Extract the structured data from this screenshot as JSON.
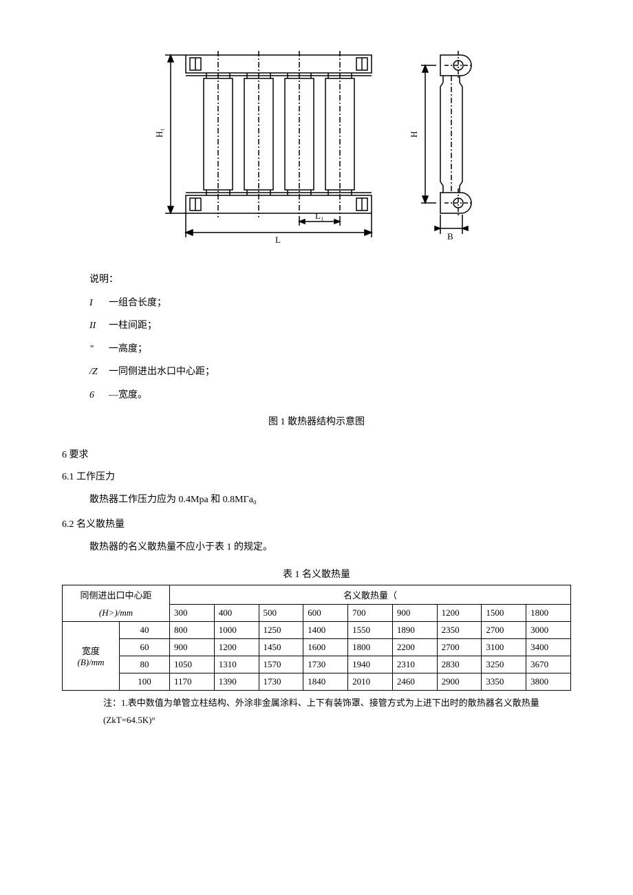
{
  "figure": {
    "labels": {
      "H1": "H₁",
      "H": "H",
      "L": "L",
      "L1": "L₁",
      "B": "B"
    },
    "caption": "图 1 散热器结构示意图"
  },
  "legend": {
    "heading": "说明：",
    "items": [
      {
        "sym": "I",
        "desc": "一组合长度；"
      },
      {
        "sym": "II",
        "desc": "一柱间距；"
      },
      {
        "sym": "\"",
        "desc": "一高度；"
      },
      {
        "sym": "/Z",
        "desc": "一同侧进出水口中心距；"
      },
      {
        "sym": "6",
        "desc": "—宽度。"
      }
    ]
  },
  "sections": {
    "s6": "6 要求",
    "s6_1": "6.1  工作压力",
    "s6_1_body": "散热器工作压力应为 0.4Mpa 和 0.8MГa₀",
    "s6_2": "6.2  名义散热量",
    "s6_2_body": "散热器的名义散热量不应小于表 1 的规定。"
  },
  "table": {
    "caption": "表 1 名义散热量",
    "row1_header": "同侧进出口中心距",
    "row1_right": "名义散热量（",
    "row2_unit": "(H>)/mm",
    "col_headers": [
      "300",
      "400",
      "500",
      "600",
      "700",
      "900",
      "1200",
      "1500",
      "1800"
    ],
    "width_label": "宽度",
    "width_unit": "(B)/mm",
    "rows": [
      {
        "w": "40",
        "v": [
          "800",
          "1000",
          "1250",
          "1400",
          "1550",
          "1890",
          "2350",
          "2700",
          "3000"
        ]
      },
      {
        "w": "60",
        "v": [
          "900",
          "1200",
          "1450",
          "1600",
          "1800",
          "2200",
          "2700",
          "3100",
          "3400"
        ]
      },
      {
        "w": "80",
        "v": [
          "1050",
          "1310",
          "1570",
          "1730",
          "1940",
          "2310",
          "2830",
          "3250",
          "3670"
        ]
      },
      {
        "w": "100",
        "v": [
          "1170",
          "1390",
          "1730",
          "1840",
          "2010",
          "2460",
          "2900",
          "3350",
          "3800"
        ]
      }
    ]
  },
  "notes": {
    "n1": "注：1.表中数值为单管立柱结构、外涂非金属涂料、上下有装饰罩、接管方式为上进下出时的散热器名义散热量",
    "n1b": "(ZkT=64.5K)°"
  }
}
